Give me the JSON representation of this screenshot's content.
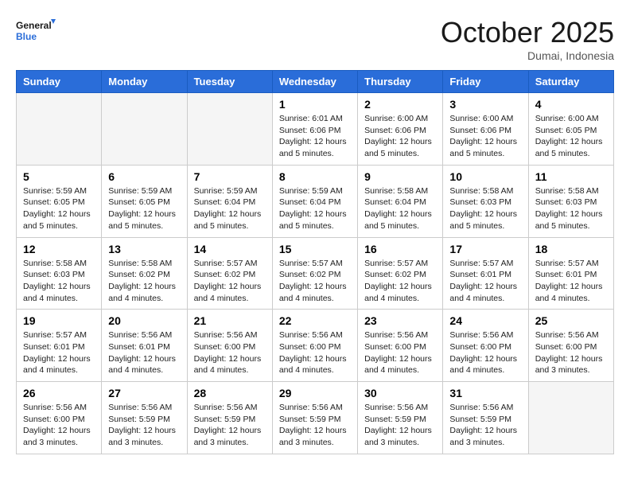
{
  "header": {
    "logo_general": "General",
    "logo_blue": "Blue",
    "month": "October 2025",
    "location": "Dumai, Indonesia"
  },
  "weekdays": [
    "Sunday",
    "Monday",
    "Tuesday",
    "Wednesday",
    "Thursday",
    "Friday",
    "Saturday"
  ],
  "weeks": [
    [
      {
        "day": "",
        "info": ""
      },
      {
        "day": "",
        "info": ""
      },
      {
        "day": "",
        "info": ""
      },
      {
        "day": "1",
        "info": "Sunrise: 6:01 AM\nSunset: 6:06 PM\nDaylight: 12 hours\nand 5 minutes."
      },
      {
        "day": "2",
        "info": "Sunrise: 6:00 AM\nSunset: 6:06 PM\nDaylight: 12 hours\nand 5 minutes."
      },
      {
        "day": "3",
        "info": "Sunrise: 6:00 AM\nSunset: 6:06 PM\nDaylight: 12 hours\nand 5 minutes."
      },
      {
        "day": "4",
        "info": "Sunrise: 6:00 AM\nSunset: 6:05 PM\nDaylight: 12 hours\nand 5 minutes."
      }
    ],
    [
      {
        "day": "5",
        "info": "Sunrise: 5:59 AM\nSunset: 6:05 PM\nDaylight: 12 hours\nand 5 minutes."
      },
      {
        "day": "6",
        "info": "Sunrise: 5:59 AM\nSunset: 6:05 PM\nDaylight: 12 hours\nand 5 minutes."
      },
      {
        "day": "7",
        "info": "Sunrise: 5:59 AM\nSunset: 6:04 PM\nDaylight: 12 hours\nand 5 minutes."
      },
      {
        "day": "8",
        "info": "Sunrise: 5:59 AM\nSunset: 6:04 PM\nDaylight: 12 hours\nand 5 minutes."
      },
      {
        "day": "9",
        "info": "Sunrise: 5:58 AM\nSunset: 6:04 PM\nDaylight: 12 hours\nand 5 minutes."
      },
      {
        "day": "10",
        "info": "Sunrise: 5:58 AM\nSunset: 6:03 PM\nDaylight: 12 hours\nand 5 minutes."
      },
      {
        "day": "11",
        "info": "Sunrise: 5:58 AM\nSunset: 6:03 PM\nDaylight: 12 hours\nand 5 minutes."
      }
    ],
    [
      {
        "day": "12",
        "info": "Sunrise: 5:58 AM\nSunset: 6:03 PM\nDaylight: 12 hours\nand 4 minutes."
      },
      {
        "day": "13",
        "info": "Sunrise: 5:58 AM\nSunset: 6:02 PM\nDaylight: 12 hours\nand 4 minutes."
      },
      {
        "day": "14",
        "info": "Sunrise: 5:57 AM\nSunset: 6:02 PM\nDaylight: 12 hours\nand 4 minutes."
      },
      {
        "day": "15",
        "info": "Sunrise: 5:57 AM\nSunset: 6:02 PM\nDaylight: 12 hours\nand 4 minutes."
      },
      {
        "day": "16",
        "info": "Sunrise: 5:57 AM\nSunset: 6:02 PM\nDaylight: 12 hours\nand 4 minutes."
      },
      {
        "day": "17",
        "info": "Sunrise: 5:57 AM\nSunset: 6:01 PM\nDaylight: 12 hours\nand 4 minutes."
      },
      {
        "day": "18",
        "info": "Sunrise: 5:57 AM\nSunset: 6:01 PM\nDaylight: 12 hours\nand 4 minutes."
      }
    ],
    [
      {
        "day": "19",
        "info": "Sunrise: 5:57 AM\nSunset: 6:01 PM\nDaylight: 12 hours\nand 4 minutes."
      },
      {
        "day": "20",
        "info": "Sunrise: 5:56 AM\nSunset: 6:01 PM\nDaylight: 12 hours\nand 4 minutes."
      },
      {
        "day": "21",
        "info": "Sunrise: 5:56 AM\nSunset: 6:00 PM\nDaylight: 12 hours\nand 4 minutes."
      },
      {
        "day": "22",
        "info": "Sunrise: 5:56 AM\nSunset: 6:00 PM\nDaylight: 12 hours\nand 4 minutes."
      },
      {
        "day": "23",
        "info": "Sunrise: 5:56 AM\nSunset: 6:00 PM\nDaylight: 12 hours\nand 4 minutes."
      },
      {
        "day": "24",
        "info": "Sunrise: 5:56 AM\nSunset: 6:00 PM\nDaylight: 12 hours\nand 4 minutes."
      },
      {
        "day": "25",
        "info": "Sunrise: 5:56 AM\nSunset: 6:00 PM\nDaylight: 12 hours\nand 3 minutes."
      }
    ],
    [
      {
        "day": "26",
        "info": "Sunrise: 5:56 AM\nSunset: 6:00 PM\nDaylight: 12 hours\nand 3 minutes."
      },
      {
        "day": "27",
        "info": "Sunrise: 5:56 AM\nSunset: 5:59 PM\nDaylight: 12 hours\nand 3 minutes."
      },
      {
        "day": "28",
        "info": "Sunrise: 5:56 AM\nSunset: 5:59 PM\nDaylight: 12 hours\nand 3 minutes."
      },
      {
        "day": "29",
        "info": "Sunrise: 5:56 AM\nSunset: 5:59 PM\nDaylight: 12 hours\nand 3 minutes."
      },
      {
        "day": "30",
        "info": "Sunrise: 5:56 AM\nSunset: 5:59 PM\nDaylight: 12 hours\nand 3 minutes."
      },
      {
        "day": "31",
        "info": "Sunrise: 5:56 AM\nSunset: 5:59 PM\nDaylight: 12 hours\nand 3 minutes."
      },
      {
        "day": "",
        "info": ""
      }
    ]
  ]
}
